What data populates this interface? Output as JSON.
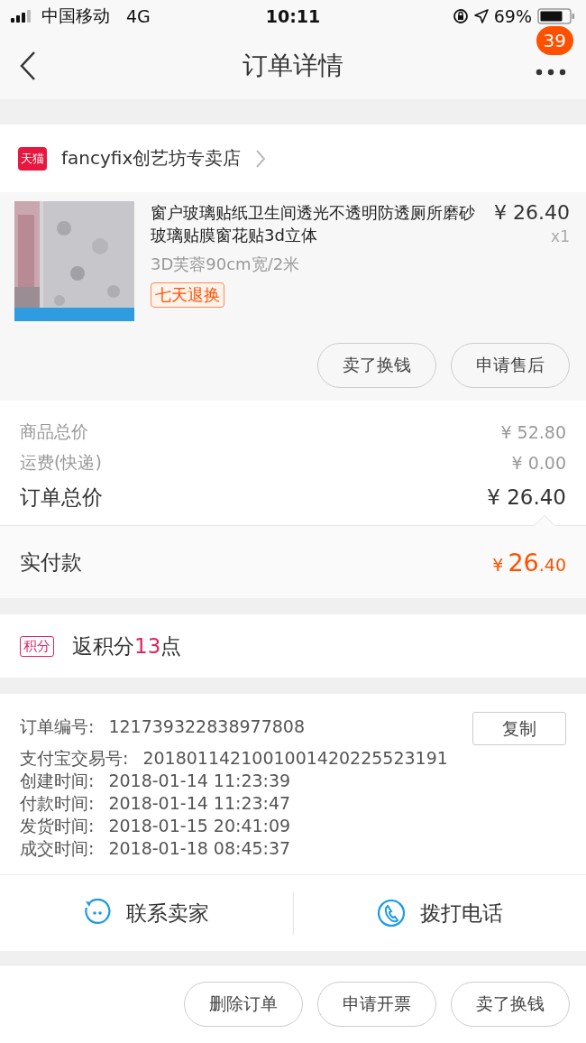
{
  "status_bar": {
    "carrier": "中国移动",
    "network": "4G",
    "time": "10:11",
    "battery": "69%"
  },
  "nav": {
    "title": "订单详情",
    "badge": "39"
  },
  "store": {
    "name": "fancyfix创艺坊专卖店",
    "badge": "天猫"
  },
  "product": {
    "image": {
      "kind": "picture"
    },
    "title": "窗户玻璃贴纸卫生间透光不透明防透厕所磨砂玻璃贴膜窗花贴3d立体",
    "price": "¥ 26.40",
    "quantity": "x1",
    "variant": "3D芙蓉90cm宽/2米",
    "tag": "七天退换",
    "buttons": [
      "卖了换钱",
      "申请售后"
    ]
  },
  "totals": [
    {
      "label": "商品总价",
      "value": "¥ 52.80",
      "kind": "minor"
    },
    {
      "label": "运费(快递)",
      "value": "¥ 0.00",
      "kind": "minor"
    },
    {
      "label": "订单总价",
      "value": "¥ 26.40",
      "kind": "major"
    }
  ],
  "paid": {
    "label": "实付款",
    "currency": "¥",
    "integer": "26",
    "decimal": ".40"
  },
  "points": {
    "badge": "积分",
    "prefix": "返积分",
    "value": "13",
    "suffix": "点"
  },
  "info": {
    "copy_button": "复制",
    "rows": [
      {
        "label": "订单编号:",
        "value": "121739322838977808"
      },
      {
        "label": "支付宝交易号:",
        "value": "2018011421001001420225523191"
      },
      {
        "label": "创建时间:",
        "value": "2018-01-14 11:23:39"
      },
      {
        "label": "付款时间:",
        "value": "2018-01-14 11:23:47"
      },
      {
        "label": "发货时间:",
        "value": "2018-01-15 20:41:09"
      },
      {
        "label": "成交时间:",
        "value": "2018-01-18 08:45:37"
      }
    ]
  },
  "contact": [
    {
      "label": "联系卖家",
      "kind": "chat"
    },
    {
      "label": "拨打电话",
      "kind": "phone"
    }
  ],
  "actions": [
    "删除订单",
    "申请开票",
    "卖了换钱"
  ]
}
